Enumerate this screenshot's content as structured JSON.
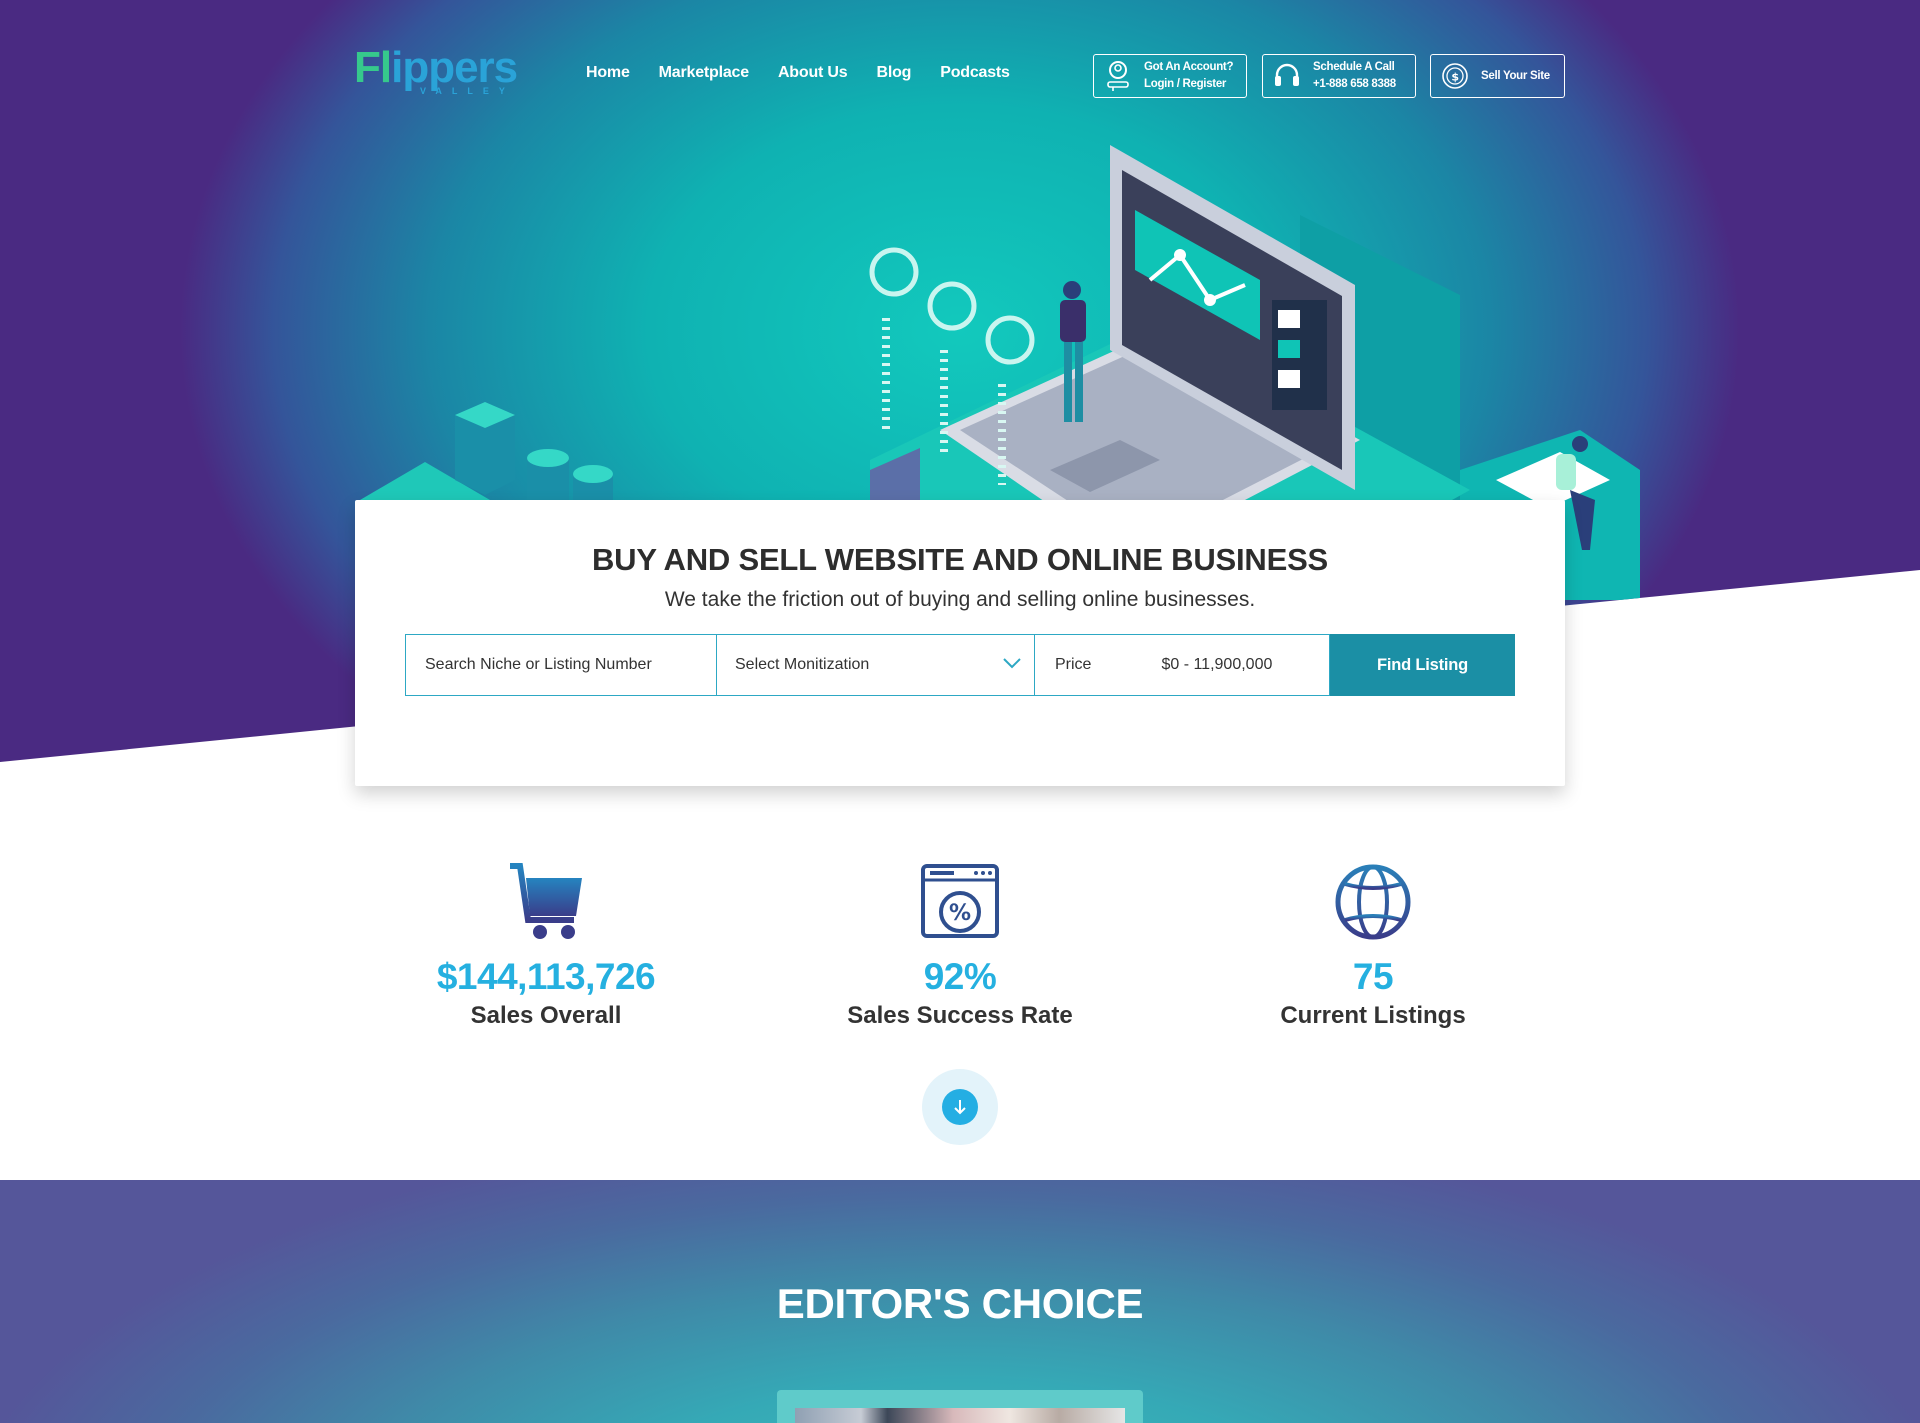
{
  "brand": {
    "logo_text": "Flippers",
    "logo_sub": "VALLEY"
  },
  "nav": {
    "items": [
      {
        "label": "Home"
      },
      {
        "label": "Marketplace"
      },
      {
        "label": "About Us"
      },
      {
        "label": "Blog"
      },
      {
        "label": "Podcasts"
      }
    ]
  },
  "header_buttons": {
    "account": {
      "line1": "Got An Account?",
      "line2": "Login / Register",
      "icon": "user-icon"
    },
    "call": {
      "line1": "Schedule A Call",
      "line2": "+1-888 658 8388",
      "icon": "headset-icon"
    },
    "sell": {
      "label": "Sell Your Site",
      "icon": "dollar-coin-icon"
    }
  },
  "search_card": {
    "title": "BUY AND SELL WEBSITE AND ONLINE BUSINESS",
    "subtitle": "We take the friction out of buying and selling online businesses.",
    "search_placeholder": "Search Niche or Listing Number",
    "monetization_selected": "Select Monitization",
    "price_label": "Price",
    "price_range": "$0 - 11,900,000",
    "find_button": "Find Listing"
  },
  "stats": [
    {
      "value": "$144,113,726",
      "label": "Sales Overall",
      "icon": "cart-icon"
    },
    {
      "value": "92%",
      "label": "Sales Success Rate",
      "icon": "percent-browser-icon"
    },
    {
      "value": "75",
      "label": "Current Listings",
      "icon": "globe-icon"
    }
  ],
  "scroll_icon": "arrow-down-icon",
  "editors_choice": {
    "title": "EDITOR'S CHOICE"
  },
  "colors": {
    "accent": "#25b0e0",
    "button": "#1b8fa5",
    "hero_teal": "#12c9bd",
    "hero_purple": "#4a2a82",
    "icon_navy": "#2f3f85"
  }
}
